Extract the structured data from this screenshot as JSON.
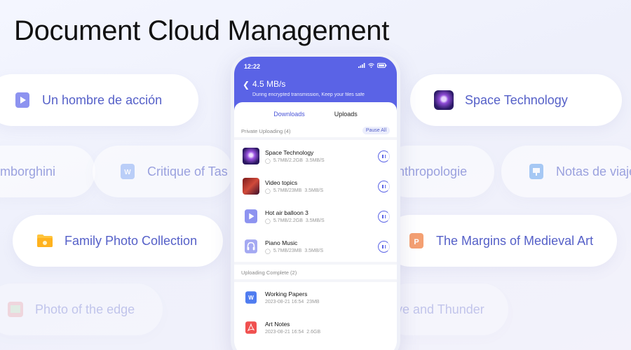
{
  "headline": "Document Cloud Management",
  "pills": {
    "r1_left": "Un hombre de acción",
    "r1_right": "Space Technology",
    "r2_left": "mborghini",
    "r2_mid": "Critique of Tas",
    "r2_right_mid": "nthropologie",
    "r2_right": "Notas de viaje",
    "r3_left": "Family Photo Collection",
    "r3_right": "The Margins of Medieval Art",
    "r4_left": "Photo of the edge",
    "r4_right": "ve and Thunder"
  },
  "phone": {
    "time": "12:22",
    "speed": "4.5 MB/s",
    "speed_subtitle": "During encrypted transmission, Keep your files safe",
    "tabs": {
      "downloads": "Downloads",
      "uploads": "Uploads"
    },
    "private_uploading": "Private Uploading  (4)",
    "pause_all": "Pause All",
    "uploading_items": [
      {
        "name": "Space Technology",
        "size": "5.7MB/2.2GB",
        "rate": "3.5MB/S"
      },
      {
        "name": "Video topics",
        "size": "5.7MB/23MB",
        "rate": "3.5MB/S"
      },
      {
        "name": "Hot air balloon 3",
        "size": "5.7MB/2.2GB",
        "rate": "3.5MB/S"
      },
      {
        "name": "Piano Music",
        "size": "5.7MB/23MB",
        "rate": "3.5MB/S"
      }
    ],
    "uploading_complete": "Uploading Complete  (2)",
    "complete_items": [
      {
        "name": "Working Papers",
        "date": "2023-08-21 16:54",
        "size": "23MB"
      },
      {
        "name": "Art Notes",
        "date": "2023-08-21 16:54",
        "size": "2.6GB"
      }
    ]
  },
  "colors": {
    "accent": "#5a63e6",
    "pill_text": "#5560c8"
  }
}
